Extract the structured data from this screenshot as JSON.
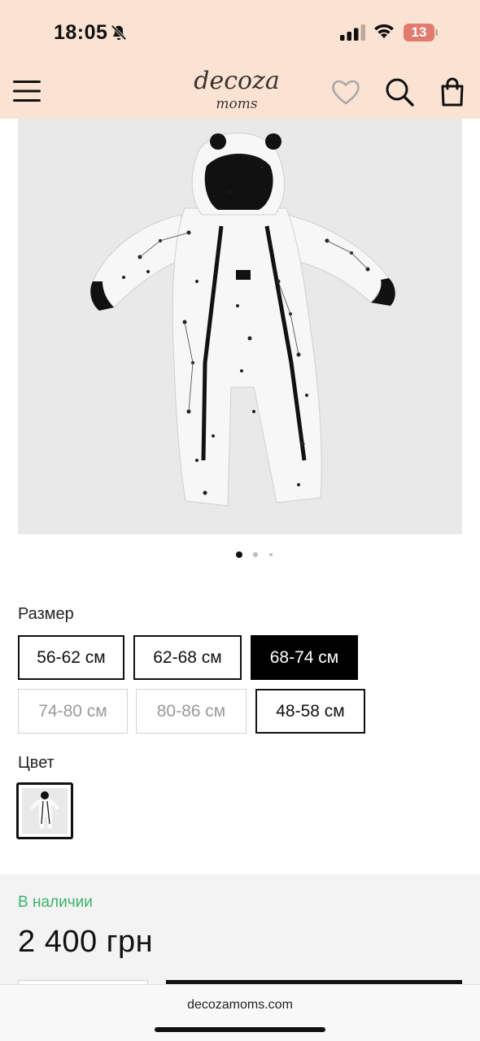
{
  "status_bar": {
    "time": "18:05",
    "battery": "13",
    "icons": [
      "bell-slash-icon",
      "cellular-signal-icon",
      "wifi-icon",
      "battery-icon"
    ]
  },
  "header": {
    "logo_main": "decoza",
    "logo_sub": "moms",
    "icons": [
      "menu-icon",
      "heart-icon",
      "search-icon",
      "shopping-bag-icon"
    ]
  },
  "gallery": {
    "total_images": 3,
    "current_index": 1
  },
  "size": {
    "label": "Размер",
    "options": [
      {
        "label": "56-62 см",
        "state": "available"
      },
      {
        "label": "62-68 см",
        "state": "available"
      },
      {
        "label": "68-74 см",
        "state": "selected"
      },
      {
        "label": "74-80 см",
        "state": "unavailable"
      },
      {
        "label": "80-86 см",
        "state": "unavailable"
      },
      {
        "label": "48-58 см",
        "state": "available"
      }
    ]
  },
  "color": {
    "label": "Цвет"
  },
  "purchase": {
    "stock_status": "В наличии",
    "price": "2 400 грн"
  },
  "browser": {
    "url": "decozamoms.com"
  },
  "colors": {
    "header_bg": "#fbe3d3",
    "accent_black": "#000000",
    "in_stock_green": "#3bb36a",
    "panel_bg": "#f3f3f3"
  }
}
